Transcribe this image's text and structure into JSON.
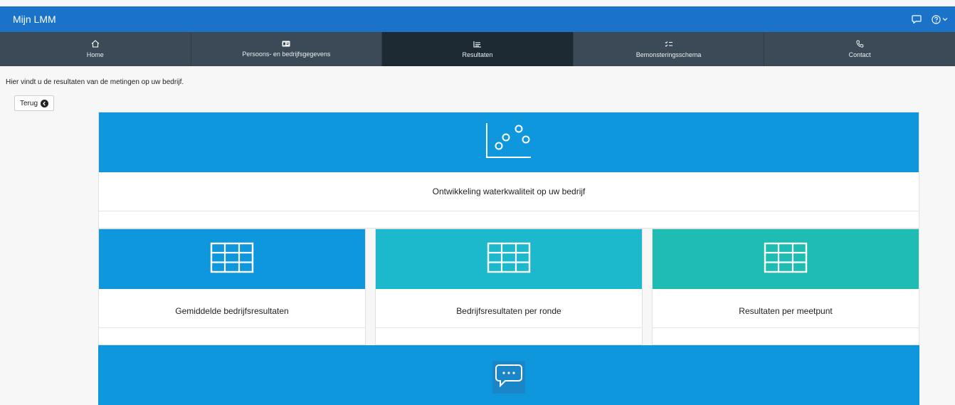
{
  "header": {
    "app_title": "Mijn LMM",
    "icons": [
      "chat-icon",
      "help-icon",
      "chevron-down-icon"
    ]
  },
  "nav": {
    "items": [
      {
        "label": "Home",
        "icon": "home-icon"
      },
      {
        "label": "Persoons- en bedrijfsgegevens",
        "icon": "id-card-icon"
      },
      {
        "label": "Resultaten",
        "icon": "results-icon",
        "active": true
      },
      {
        "label": "Bemonsteringsschema",
        "icon": "checklist-icon"
      },
      {
        "label": "Contact",
        "icon": "phone-icon"
      }
    ]
  },
  "main": {
    "intro": "Hier vindt u de resultaten van de metingen op uw bedrijf.",
    "back_label": "Terug",
    "cards": [
      {
        "label": "Ontwikkeling waterkwaliteit op uw bedrijf",
        "icon": "scatter-chart-icon",
        "color": "#0e97dc"
      },
      {
        "label": "Gemiddelde bedrijfsresultaten",
        "icon": "table-icon",
        "color": "#0e97dc"
      },
      {
        "label": "Bedrijfsresultaten per ronde",
        "icon": "table-icon",
        "color": "#1cb8cc"
      },
      {
        "label": "Resultaten per meetpunt",
        "icon": "table-icon",
        "color": "#1ebcb3"
      },
      {
        "label": "",
        "icon": "chat-bubble-icon",
        "color": "#0e97dc"
      }
    ]
  },
  "colors": {
    "topbar": "#1a73c8",
    "navbar": "#3b4a56",
    "nav_active": "#1d2a33"
  }
}
